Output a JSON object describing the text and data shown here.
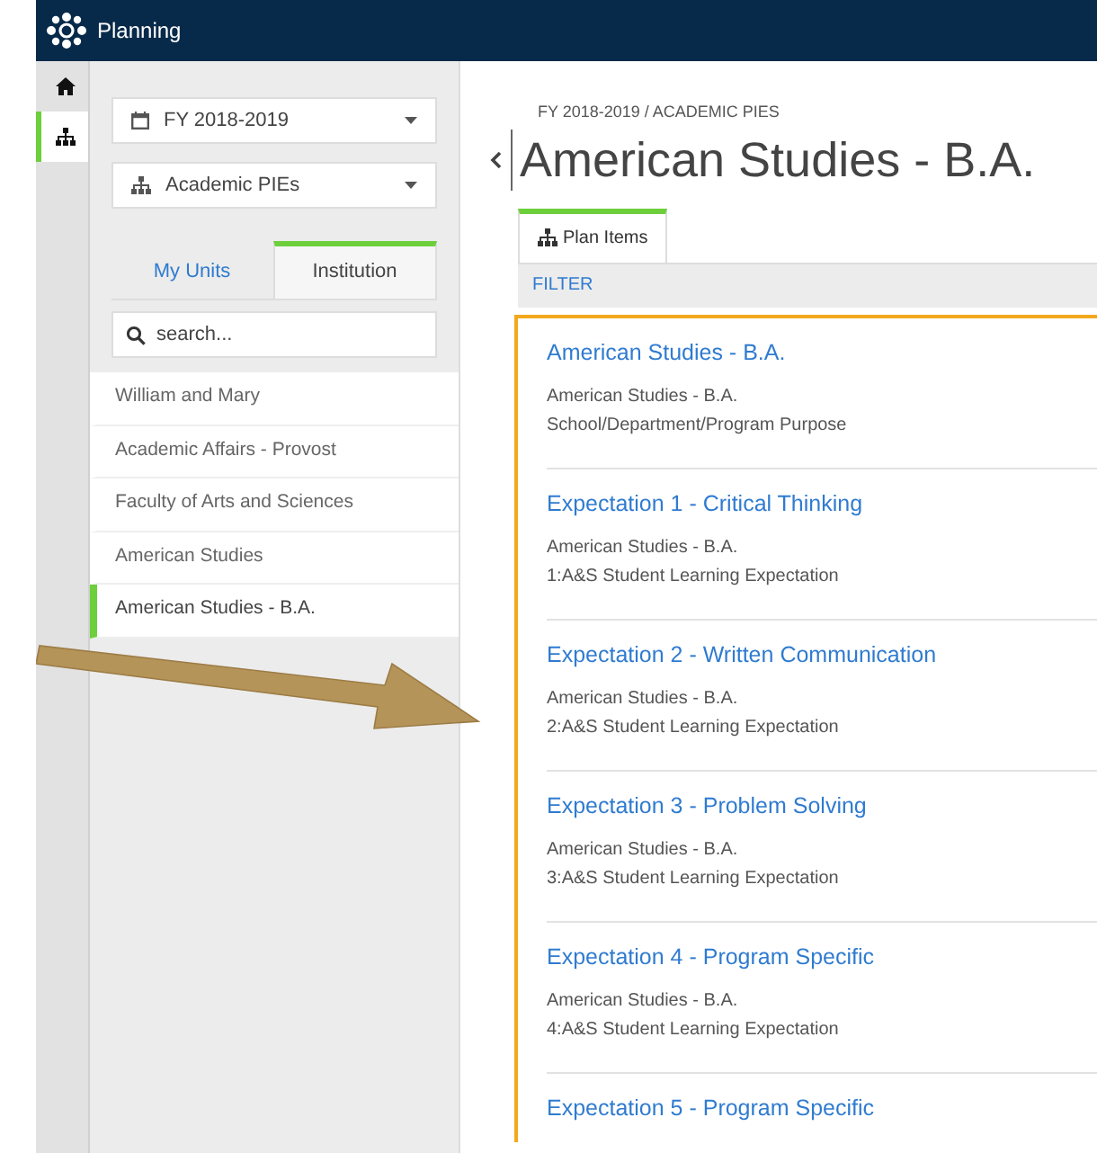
{
  "app": {
    "title": "Planning"
  },
  "rail": [
    {
      "kind": "home",
      "selected": false
    },
    {
      "kind": "hierarchy",
      "selected": true
    }
  ],
  "selectors": [
    {
      "kind": "calendar",
      "label": "FY 2018-2019"
    },
    {
      "kind": "hierarchy",
      "label": "Academic PIEs"
    }
  ],
  "unit_tabs": [
    {
      "label": "My Units",
      "selected": false
    },
    {
      "label": "Institution",
      "selected": true
    }
  ],
  "search": {
    "placeholder": "search..."
  },
  "units": [
    {
      "label": "William and Mary",
      "selected": false
    },
    {
      "label": "Academic Affairs - Provost",
      "selected": false
    },
    {
      "label": "Faculty of Arts and Sciences",
      "selected": false
    },
    {
      "label": "American Studies",
      "selected": false
    },
    {
      "label": "American Studies - B.A.",
      "selected": true
    }
  ],
  "breadcrumb": "FY 2018-2019 / ACADEMIC PIES",
  "page_title": "American Studies - B.A.",
  "content_tabs": [
    {
      "label": "Plan Items",
      "selected": true
    }
  ],
  "filter": "FILTER",
  "plan_items": [
    {
      "title": "American Studies - B.A.",
      "unit": "American Studies - B.A.",
      "type": "School/Department/Program Purpose"
    },
    {
      "title": "Expectation 1 - Critical Thinking",
      "unit": "American Studies - B.A.",
      "type": "1:A&S Student Learning Expectation"
    },
    {
      "title": "Expectation 2 - Written Communication",
      "unit": "American Studies - B.A.",
      "type": "2:A&S Student Learning Expectation"
    },
    {
      "title": "Expectation 3 - Problem Solving",
      "unit": "American Studies - B.A.",
      "type": "3:A&S Student Learning Expectation"
    },
    {
      "title": "Expectation 4 - Program Specific",
      "unit": "American Studies - B.A.",
      "type": "4:A&S Student Learning Expectation"
    },
    {
      "title": "Expectation 5 - Program Specific"
    }
  ]
}
